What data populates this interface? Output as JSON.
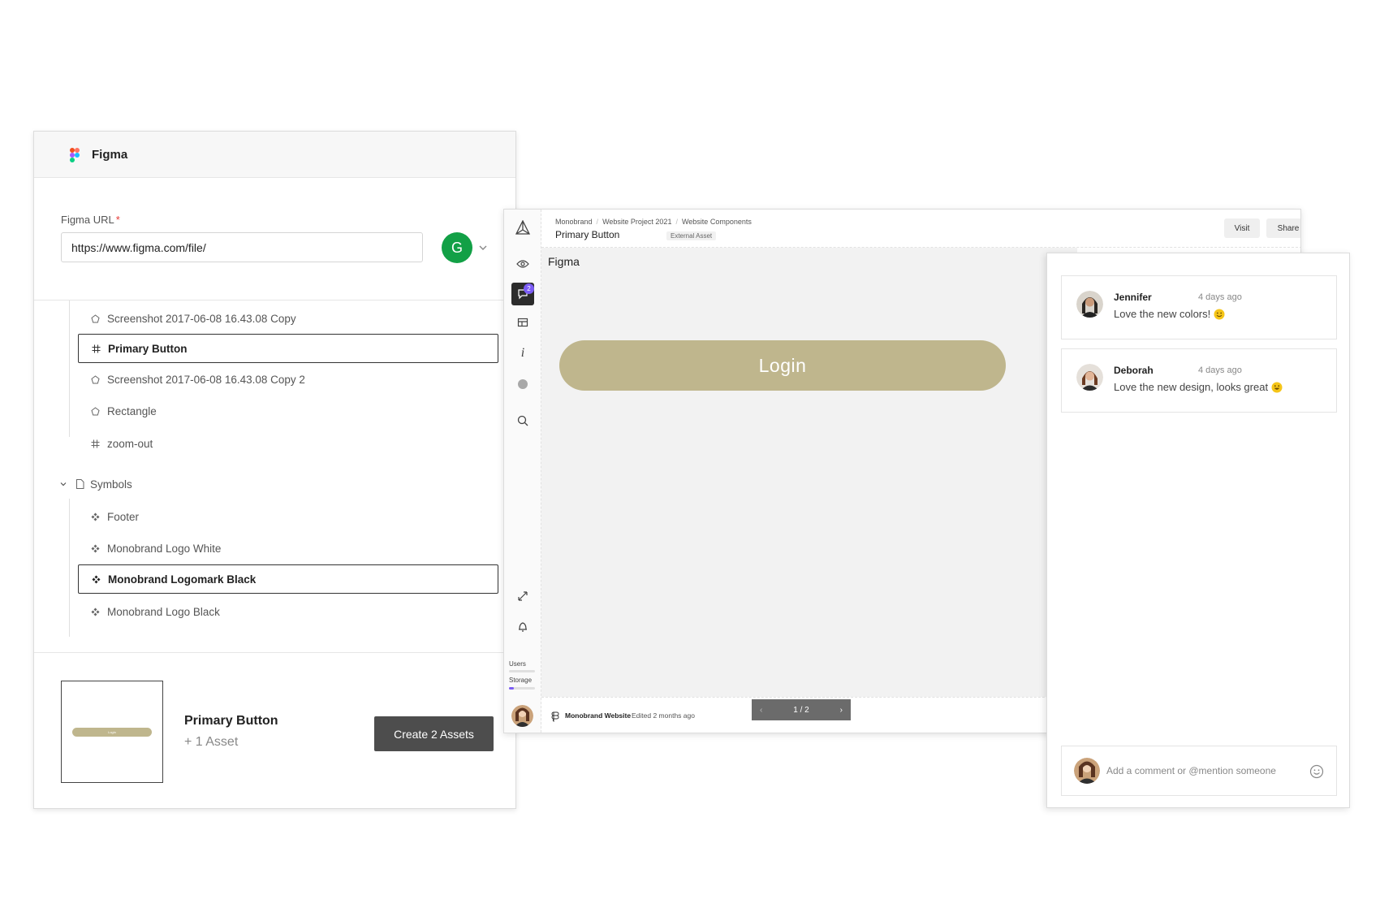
{
  "import_panel": {
    "title": "Figma",
    "url_label": "Figma URL",
    "required_mark": "*",
    "url_value": "https://www.figma.com/file/",
    "account_initial": "G",
    "tree": [
      {
        "label": "Screenshot 2017-06-08 16.43.08 Copy",
        "icon": "pentagon-icon",
        "selected": false
      },
      {
        "label": "Primary Button",
        "icon": "frame-icon",
        "selected": true
      },
      {
        "label": "Screenshot 2017-06-08 16.43.08 Copy 2",
        "icon": "pentagon-icon",
        "selected": false
      },
      {
        "label": "Rectangle",
        "icon": "pentagon-icon",
        "selected": false
      },
      {
        "label": "zoom-out",
        "icon": "frame-icon",
        "selected": false
      },
      {
        "label": "Symbols",
        "icon": "page-icon",
        "selected": false,
        "expanded": true
      },
      {
        "label": "Footer",
        "icon": "component-icon",
        "selected": false
      },
      {
        "label": "Monobrand Logo White",
        "icon": "component-icon",
        "selected": false
      },
      {
        "label": "Monobrand Logomark Black",
        "icon": "component-icon",
        "selected": true
      },
      {
        "label": "Monobrand Logo Black",
        "icon": "component-icon",
        "selected": false
      }
    ],
    "thumbnail_label": "Login",
    "asset_name": "Primary Button",
    "asset_extra": "+ 1 Asset",
    "create_button": "Create 2 Assets"
  },
  "viewer": {
    "breadcrumb": [
      "Monobrand",
      "Website Project 2021",
      "Website Components"
    ],
    "title": "Primary Button",
    "badge": "External Asset",
    "visit_button": "Visit",
    "share_button": "Share",
    "comment_count": "2",
    "canvas_label": "Figma",
    "button_preview_text": "Login",
    "users_label": "Users",
    "storage_label": "Storage",
    "storage_fraction": 0.2,
    "footer_name": "Monobrand Website",
    "footer_edited": "Edited 2 months ago",
    "page_indicator": "1 / 2",
    "zoom_in": "+",
    "zoom_out": "−"
  },
  "comments": {
    "items": [
      {
        "author": "Jennifer",
        "time": "4 days ago",
        "text": "Love the new colors!",
        "emoji": "smile"
      },
      {
        "author": "Deborah",
        "time": "4 days ago",
        "text": "Love the new design, looks great",
        "emoji": "grin"
      }
    ],
    "input_placeholder": "Add a comment or @mention someone"
  },
  "colors": {
    "accent_pill": "#bfb68d",
    "dark_button": "#4d4d4d",
    "avatar_green": "#12a046",
    "badge_purple": "#7b5cf5"
  }
}
